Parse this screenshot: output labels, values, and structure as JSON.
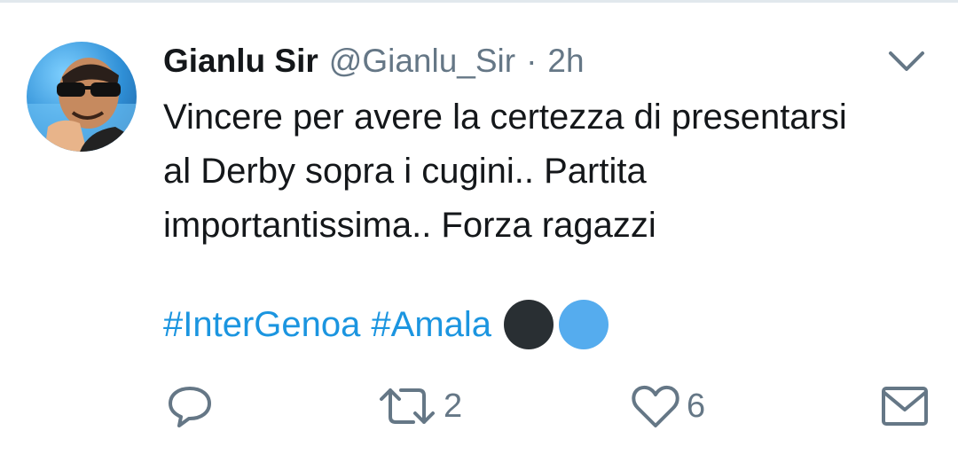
{
  "tweet": {
    "display_name": "Gianlu Sir",
    "handle": "@Gianlu_Sir",
    "separator": "·",
    "time": "2h",
    "text_lines": [
      "Vincere per avere la certezza di presentarsi",
      "al Derby sopra i cugini.. Partita",
      "importantissima.. Forza ragazzi"
    ],
    "hashtags": [
      "#InterGenoa",
      "#Amala"
    ],
    "emoji": [
      {
        "name": "black-circle",
        "color": "#292f33"
      },
      {
        "name": "blue-circle",
        "color": "#55acee"
      }
    ]
  },
  "actions": {
    "reply": {
      "icon": "reply-icon",
      "count": ""
    },
    "retweet": {
      "icon": "retweet-icon",
      "count": "2"
    },
    "like": {
      "icon": "heart-icon",
      "count": "6"
    },
    "message": {
      "icon": "envelope-icon",
      "count": ""
    }
  },
  "colors": {
    "link": "#1b95e0",
    "secondary_text": "#657786",
    "primary_text": "#14171a"
  }
}
